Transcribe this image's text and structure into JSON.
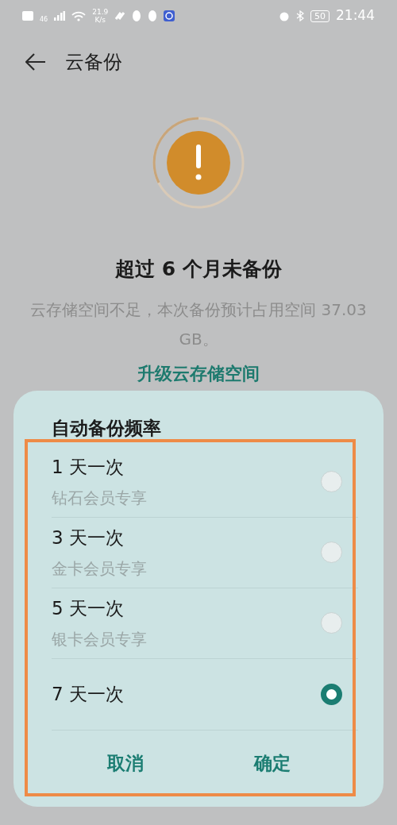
{
  "status_bar": {
    "network": "46",
    "speed": "21.9",
    "speed_unit": "K/s",
    "battery": "50",
    "time": "21:44"
  },
  "header": {
    "title": "云备份"
  },
  "warning": {
    "title": "超过 6 个月未备份",
    "message": "云存储空间不足，本次备份预计占用空间 37.03 GB。",
    "link": "升级云存储空间"
  },
  "sheet": {
    "title": "自动备份频率",
    "options": [
      {
        "label": "1 天一次",
        "note": "钻石会员专享",
        "selected": false
      },
      {
        "label": "3 天一次",
        "note": "金卡会员专享",
        "selected": false
      },
      {
        "label": "5 天一次",
        "note": "银卡会员专享",
        "selected": false
      },
      {
        "label": "7 天一次",
        "selected": true
      }
    ],
    "buttons": [
      "取消",
      "确定"
    ]
  }
}
